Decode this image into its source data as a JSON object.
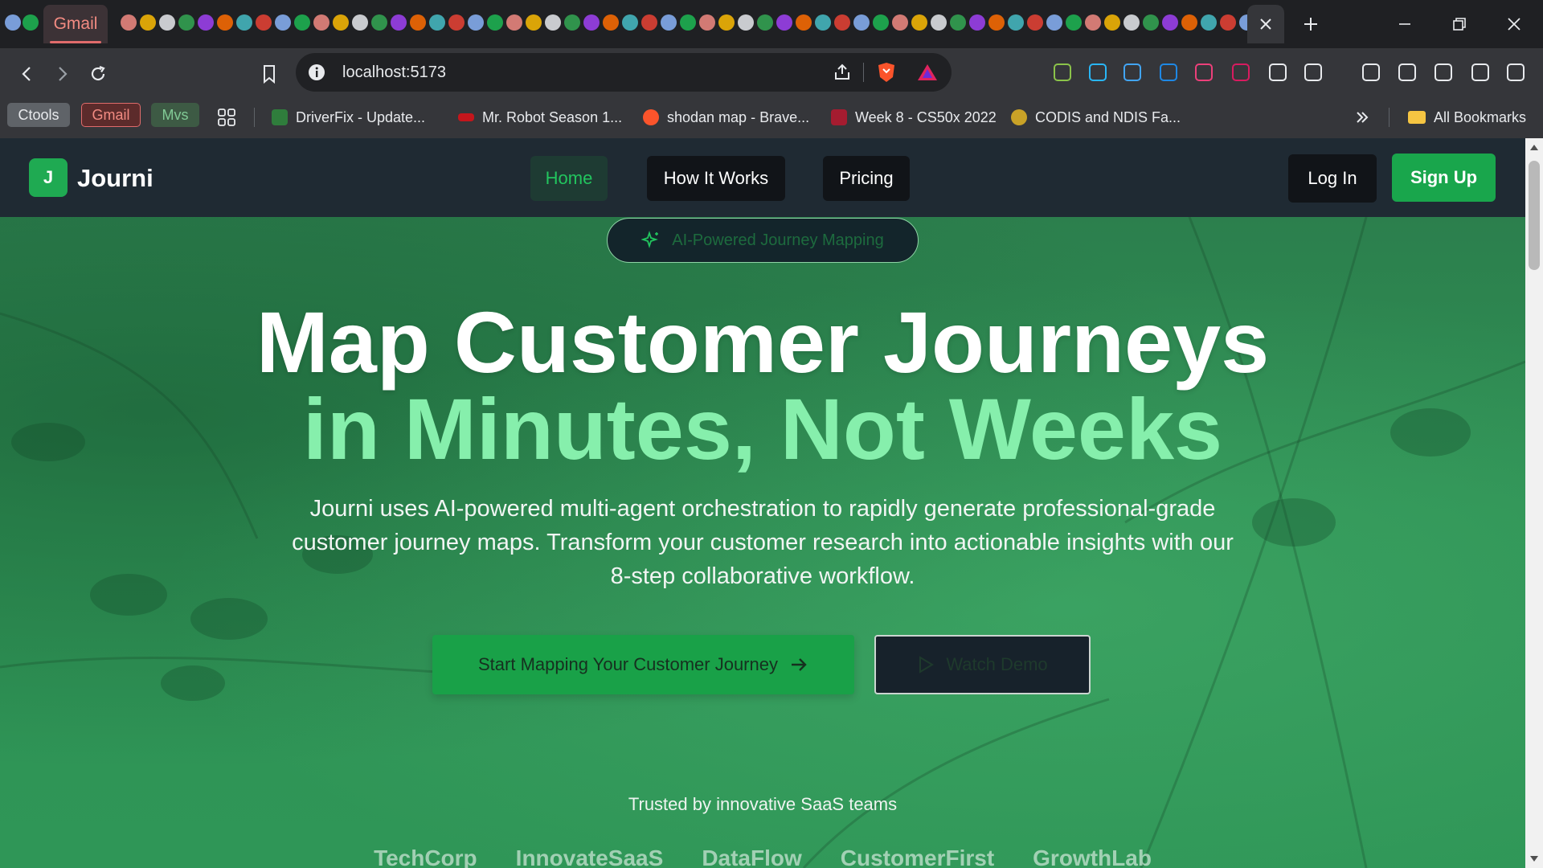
{
  "browser": {
    "tabs": {
      "gmail_label": "Gmail",
      "close_icon": "close-icon",
      "new_tab_icon": "plus-icon"
    },
    "window_controls": [
      "minimize-icon",
      "restore-icon",
      "close-icon"
    ],
    "toolbar": {
      "url": "localhost:5173"
    },
    "bookmarks": {
      "chips": [
        "Ctools",
        "Gmail",
        "Mvs"
      ],
      "items": [
        "DriverFix - Update...",
        "Mr. Robot Season 1...",
        "shodan map - Brave...",
        "Week 8 - CS50x 2022",
        "CODIS and NDIS Fa..."
      ],
      "all_bookmarks": "All Bookmarks"
    }
  },
  "site": {
    "brand": {
      "logo_letter": "J",
      "name": "Journi"
    },
    "nav": [
      "Home",
      "How It Works",
      "Pricing"
    ],
    "auth": {
      "login": "Log In",
      "signup": "Sign Up"
    },
    "hero": {
      "badge": "AI-Powered Journey Mapping",
      "title_line1": "Map Customer Journeys",
      "title_line2": "in Minutes, Not Weeks",
      "subtitle": "Journi uses AI-powered multi-agent orchestration to rapidly generate professional-grade customer journey maps. Transform your customer research into actionable insights with our 8-step collaborative workflow.",
      "cta_primary": "Start Mapping Your Customer Journey",
      "cta_secondary": "Watch Demo"
    },
    "trusted": {
      "label": "Trusted by innovative SaaS teams",
      "logos": [
        "TechCorp",
        "InnovateSaaS",
        "DataFlow",
        "CustomerFirst",
        "GrowthLab"
      ]
    }
  },
  "colors": {
    "brand_green": "#19a64c",
    "accent_light_green": "#86efac",
    "header_bg": "#1f2a33"
  }
}
